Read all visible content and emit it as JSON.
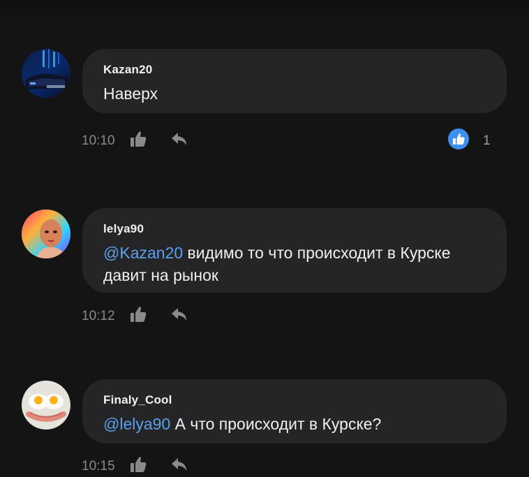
{
  "comments": [
    {
      "author": "Kazan20",
      "mention": "",
      "text": "Наверх",
      "time": "10:10",
      "likes": "1"
    },
    {
      "author": "lelya90",
      "mention": "@Kazan20",
      "text": "видимо то что происходит в Курске давит на рынок",
      "time": "10:12",
      "likes": ""
    },
    {
      "author": "Finaly_Cool",
      "mention": "@lelya90",
      "text": "А что происходит в Курске?",
      "time": "10:15",
      "likes": ""
    }
  ],
  "icons": {
    "like": "thumbs-up-icon",
    "reply": "reply-arrow-icon",
    "liked_badge": "thumbs-up-badge-icon"
  },
  "colors": {
    "background": "#141414",
    "bubble": "#252527",
    "mention": "#5aa0ee",
    "like_badge": "#3d8ff0",
    "meta_text": "#8a8a8c"
  }
}
